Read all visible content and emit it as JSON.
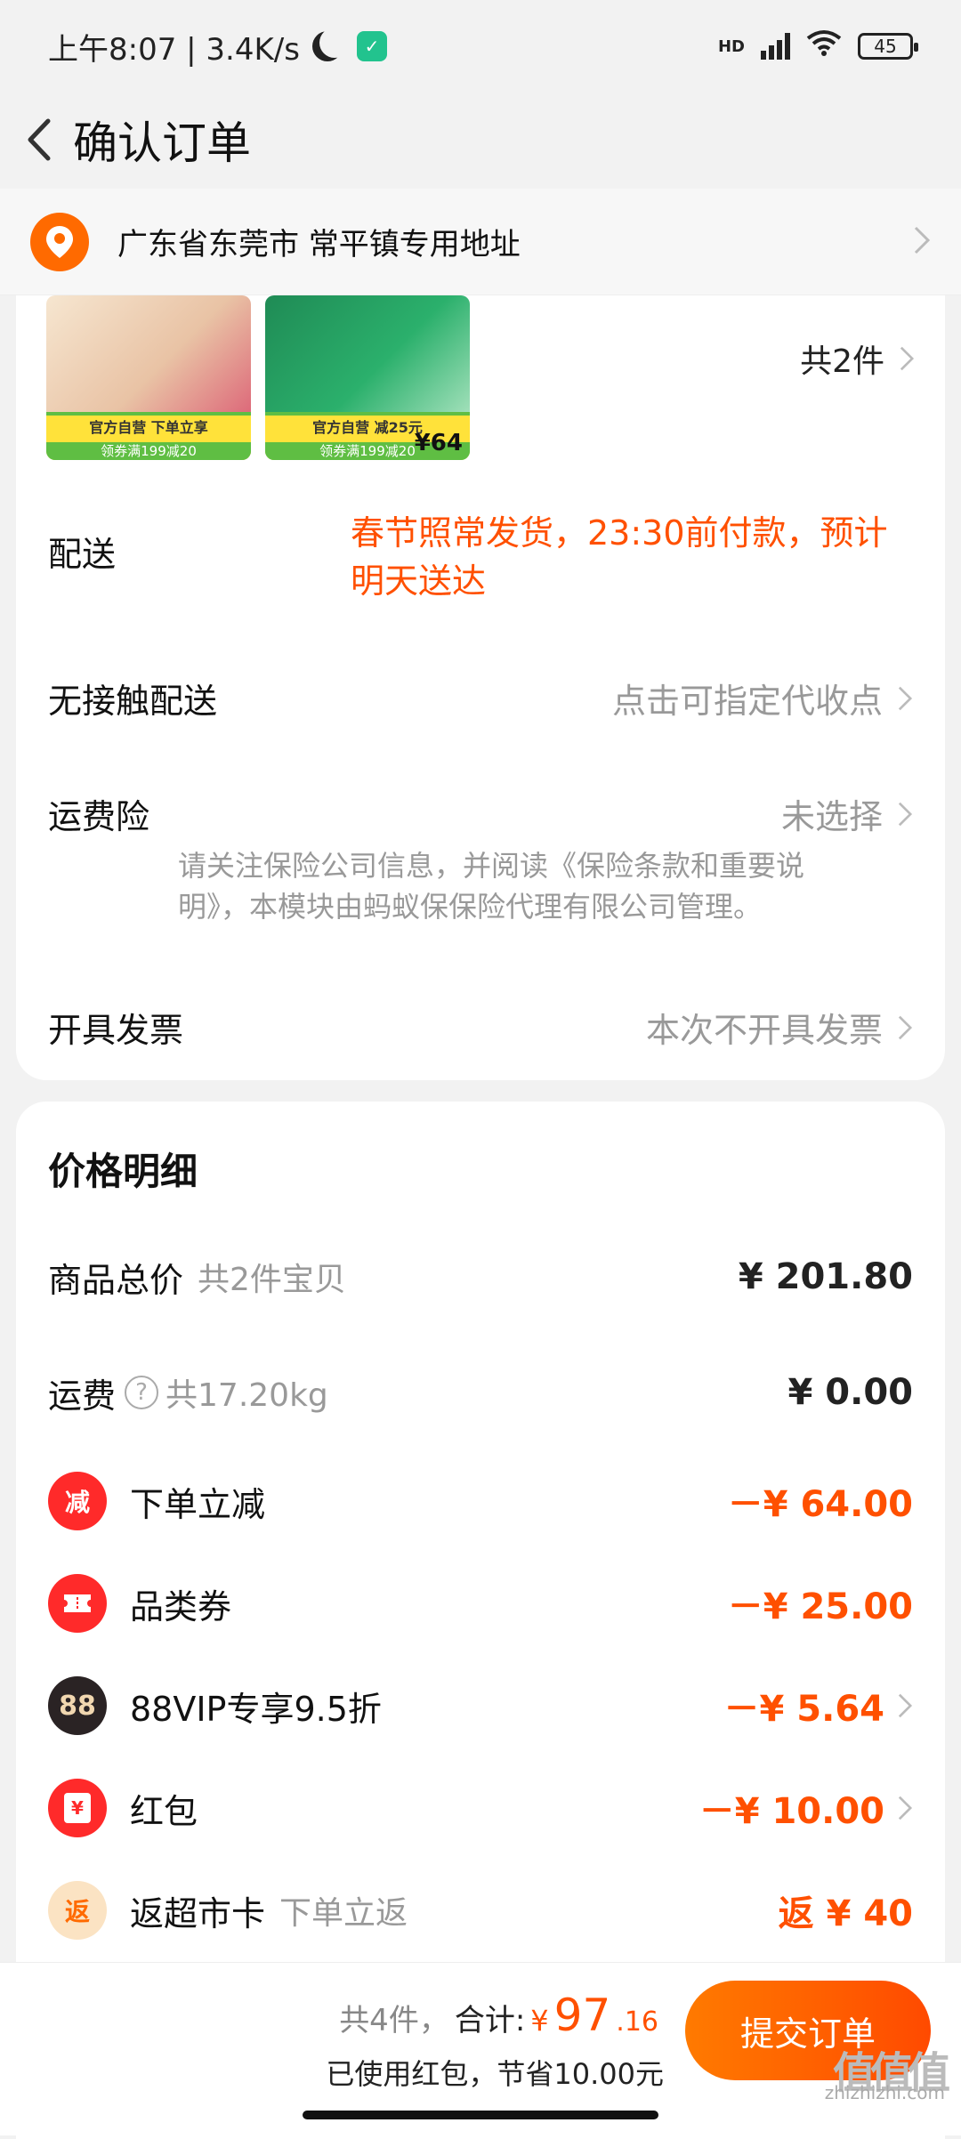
{
  "status_bar": {
    "time": "上午8:07 | 3.4K/s",
    "network": "HD",
    "battery": "45"
  },
  "header": {
    "title": "确认订单"
  },
  "address": {
    "text": "广东省东莞市 常平镇专用地址"
  },
  "products": {
    "item1": {
      "banner_top": "官方自营 下单立享",
      "banner_bottom": "领券满199减20"
    },
    "item2": {
      "banner_top": "官方自营 减25元",
      "banner_bottom": "领券满199减20",
      "price": "¥64"
    },
    "count": "共2件"
  },
  "rows": {
    "delivery_label": "配送",
    "delivery_value": "春节照常发货，23:30前付款，预计明天送达",
    "contactless_label": "无接触配送",
    "contactless_value": "点击可指定代收点",
    "insurance_label": "运费险",
    "insurance_value": "未选择",
    "insurance_note": "请关注保险公司信息，并阅读《保险条款和重要说明》，本模块由蚂蚁保保险代理有限公司管理。",
    "invoice_label": "开具发票",
    "invoice_value": "本次不开具发票"
  },
  "price_detail": {
    "title": "价格明细",
    "goods_total_label": "商品总价",
    "goods_total_sub": "共2件宝贝",
    "goods_total_amount": "¥ 201.80",
    "shipping_label": "运费",
    "shipping_sub": "共17.20kg",
    "shipping_amount": "¥ 0.00",
    "items": [
      {
        "icon": "减",
        "label": "下单立减",
        "sub": "",
        "amount": "－¥ 64.00"
      },
      {
        "icon": "",
        "label": "品类券",
        "sub": "",
        "amount": "－¥ 25.00"
      },
      {
        "icon": "88",
        "label": "88VIP专享9.5折",
        "sub": "",
        "amount": "－¥ 5.64"
      },
      {
        "icon": "¥",
        "label": "红包",
        "sub": "",
        "amount": "－¥ 10.00"
      },
      {
        "icon": "返",
        "label": "返超市卡",
        "sub": "下单立返",
        "amount": "返 ¥ 40"
      }
    ]
  },
  "bottom": {
    "count_text": "共4件，",
    "total_label": "合计:",
    "yen": "¥",
    "total_int": "97",
    "total_dec": ".16",
    "saved_text": "已使用红包，节省10.00元",
    "submit_label": "提交订单"
  },
  "watermark": {
    "logo": "值值值",
    "domain": "zhizhizhi.com"
  }
}
